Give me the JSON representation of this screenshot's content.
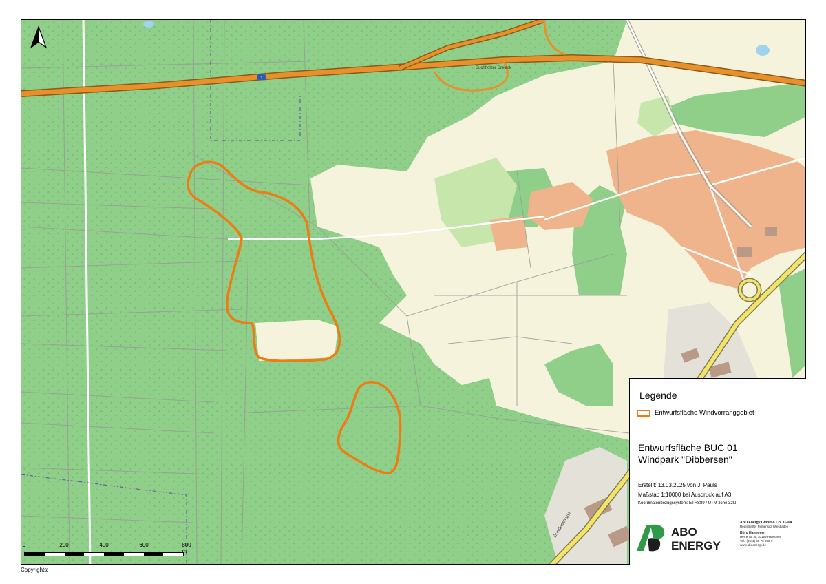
{
  "map": {
    "north_label": "north-arrow",
    "road_labels": {
      "autobahn_junction": "Buchholzer Dreieck",
      "a1_shield": "1",
      "bundesstrasse": "Bundesstraße"
    }
  },
  "scalebar": {
    "ticks": [
      "0",
      "200",
      "400",
      "600",
      "800 m"
    ]
  },
  "copyright": "Copyrights:",
  "legend": {
    "title": "Legende",
    "items": [
      {
        "label": "Entwurfsfläche Windvorranggebiet",
        "color": "#f07b12"
      }
    ]
  },
  "project": {
    "title_line1": "Entwurfsfläche BUC 01",
    "title_line2": "Windpark \"Dibbersen\"",
    "created": "Erstellt: 13.03.2025 von J. Pauls",
    "scale": "Maßstab 1:10000  bei Ausdruck auf A3",
    "crs": "Koordinatenbezugssystem: ETRS89 / UTM zone 32N"
  },
  "company": {
    "logo_line1": "ABO",
    "logo_line2": "ENERGY",
    "name": "ABO Energy GmbH & Co. KGaA",
    "register": "Registrierter Firmensitz Wiesbaden",
    "office": "Büro Hannover",
    "address": "Herrenstr. 6, 30159 Hannover",
    "phone": "Tel.: (0511) 95 73 980-0",
    "web": "www.aboenergy.de"
  },
  "colors": {
    "forest": "#8fcf8a",
    "field": "#f6f3dc",
    "settlement": "#f0b48c",
    "motorway": "#e8902a",
    "windzone": "#f07b12",
    "logo_green": "#2f9a48"
  }
}
